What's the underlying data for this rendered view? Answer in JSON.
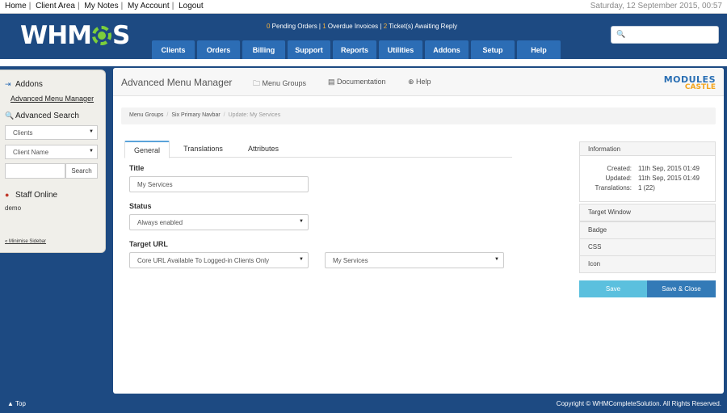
{
  "topbar": {
    "links": [
      "Home",
      "Client Area",
      "My Notes",
      "My Account",
      "Logout"
    ],
    "date": "Saturday, 12 September 2015, 00:57"
  },
  "header": {
    "logo_pre": "WHM",
    "logo_post": "S",
    "alerts": {
      "pending_count": "0",
      "pending_label": " Pending Orders | ",
      "overdue_count": "1",
      "overdue_label": " Overdue Invoices | ",
      "tickets_count": "2",
      "tickets_label": " Ticket(s) Awaiting Reply"
    },
    "search_placeholder": "",
    "search_icon": "search-icon",
    "nav": [
      "Clients",
      "Orders",
      "Billing",
      "Support",
      "Reports",
      "Utilities",
      "Addons",
      "Setup",
      "Help"
    ]
  },
  "sidebar": {
    "addons_title": "Addons",
    "addons_link": "Advanced Menu Manager",
    "search_title": "Advanced Search",
    "search_type": "Clients",
    "search_field": "Client Name",
    "search_value": "",
    "search_button": "Search",
    "staff_title": "Staff Online",
    "staff_user": "demo",
    "minimise": "« Minimise Sidebar"
  },
  "main": {
    "title": "Advanced Menu Manager",
    "links": [
      "Menu Groups",
      "Documentation",
      "Help"
    ],
    "brand_top": "MODULES",
    "brand_bottom": "CASTLE",
    "breadcrumb": [
      "Menu Groups",
      "Six Primary Navbar",
      "Update: My Services"
    ],
    "tabs": [
      "General",
      "Translations",
      "Attributes"
    ],
    "form": {
      "title_label": "Title",
      "title_value": "My Services",
      "status_label": "Status",
      "status_value": "Always enabled",
      "url_label": "Target URL",
      "url_type": "Core URL Available To Logged-in Clients Only",
      "url_target": "My Services"
    },
    "info": {
      "header": "Information",
      "created_label": "Created:",
      "created_value": "11th Sep, 2015 01:49",
      "updated_label": "Updated:",
      "updated_value": "11th Sep, 2015 01:49",
      "translations_label": "Translations:",
      "translations_value": "1 (22)"
    },
    "panels": [
      "Target Window",
      "Badge",
      "CSS",
      "Icon"
    ],
    "save": "Save",
    "save_close": "Save & Close"
  },
  "footer": {
    "top": "▲ Top",
    "copyright": "Copyright © WHMCompleteSolution. All Rights Reserved."
  },
  "colors": {
    "header_bg": "#1d4a82",
    "nav_tab": "#2c6db5",
    "save_btn": "#5bc0de",
    "save_close_btn": "#337ab7",
    "alert_count": "#f6b23c"
  }
}
